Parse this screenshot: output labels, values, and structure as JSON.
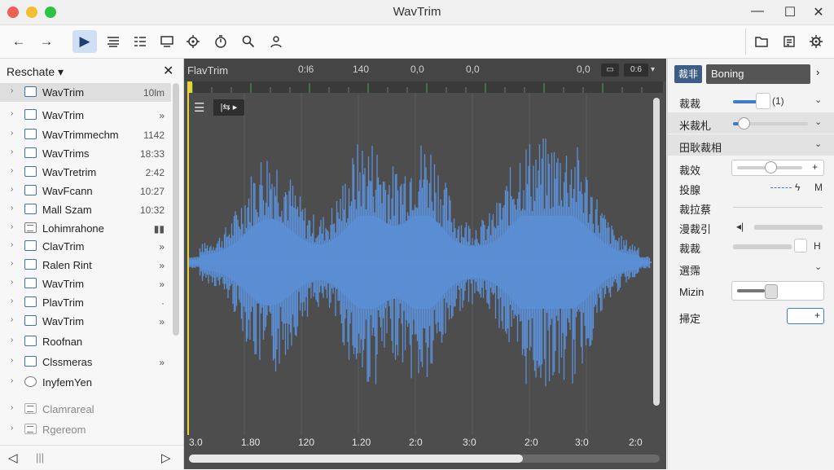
{
  "window": {
    "title": "WavTrim",
    "minimize_label": "—",
    "maximize_label": "☐",
    "close_label": "✕"
  },
  "toolbar": {
    "back_icon": "←",
    "forward_icon": "→",
    "play_icon": "▶",
    "buttons": [
      "align-icon",
      "list-icon",
      "monitor-icon",
      "chip-icon",
      "timer-icon",
      "search-icon",
      "user-icon"
    ],
    "right_icons": [
      "folder-icon",
      "export-icon",
      "gear-icon"
    ]
  },
  "sidebar": {
    "title": "Reschate ▾",
    "close": "✕",
    "items": [
      {
        "label": "WavTrim",
        "value": "10lm",
        "icon": "file",
        "selected": true
      },
      {
        "label": "WavTrim",
        "value": "»",
        "icon": "folder"
      },
      {
        "label": "WavTrimmechm",
        "value": "1142",
        "icon": "folder"
      },
      {
        "label": "WavTrims",
        "value": "18:33",
        "icon": "folder"
      },
      {
        "label": "WavTretrim",
        "value": "2:42",
        "icon": "folder"
      },
      {
        "label": "WavFcann",
        "value": "10:27",
        "icon": "folder"
      },
      {
        "label": "Mall Szam",
        "value": "10:32",
        "icon": "folder"
      },
      {
        "label": "Lohimrahone",
        "value": "▮▮",
        "icon": "list"
      },
      {
        "label": "ClavTrim",
        "value": "»",
        "icon": "folder"
      },
      {
        "label": "Ralen Rint",
        "value": "»",
        "icon": "folder"
      },
      {
        "label": "WavTrim",
        "value": "»",
        "icon": "folder"
      },
      {
        "label": "PlavTrim",
        "value": "·",
        "icon": "folder"
      },
      {
        "label": "WavTrim",
        "value": "»",
        "icon": "folder"
      },
      {
        "label": "Roofnan",
        "value": "",
        "icon": "folder"
      },
      {
        "label": "Clssmeras",
        "value": "»",
        "icon": "folder"
      },
      {
        "label": "InyfemYen",
        "value": "",
        "icon": "round"
      },
      {
        "label": "Clamrareal",
        "value": "",
        "icon": "list",
        "dim": true
      },
      {
        "label": "Rgereom",
        "value": "",
        "icon": "list",
        "dim": true
      }
    ],
    "footer": {
      "left": "◁",
      "mid": "|||",
      "right": "▷"
    }
  },
  "editor": {
    "title": "FlavTrim",
    "header_values": [
      "0:l6",
      "140",
      "0,0",
      "0,0",
      "0,0"
    ],
    "btn_a": "▭",
    "btn_b": "0:6",
    "btn_b_arrow": "▾",
    "mini_menu": "☰",
    "mini_box": "|⇆ ▸",
    "axis_labels": [
      "3.0",
      "1.80",
      "120",
      "1.20",
      "2:0",
      "3:0",
      "2:0",
      "3:0",
      "2:0"
    ]
  },
  "inspector": {
    "tag": "裁非",
    "field": "Boning",
    "more": "›",
    "rows": [
      {
        "label": "裁裁",
        "value": "(1)",
        "level": 0.55
      },
      {
        "label": "米裁札",
        "level": 0.12
      },
      {
        "label": "田耿裁相"
      },
      {
        "label": "裁效",
        "value": "+",
        "level": 0.45
      },
      {
        "label": "投腺",
        "value": "M",
        "suffix": "ϟ"
      },
      {
        "label": "裁拉蔡"
      },
      {
        "label": "漫裁引",
        "value": "◂|"
      },
      {
        "label": "裁裁",
        "value": "H"
      },
      {
        "label": "選霈"
      },
      {
        "label": "Mizin",
        "level": 0.55
      },
      {
        "label": "掃定",
        "value": "+"
      }
    ]
  },
  "colors": {
    "waveform": "#5b8fd6",
    "playhead": "#e8d43a",
    "accent": "#3a7ad8"
  }
}
